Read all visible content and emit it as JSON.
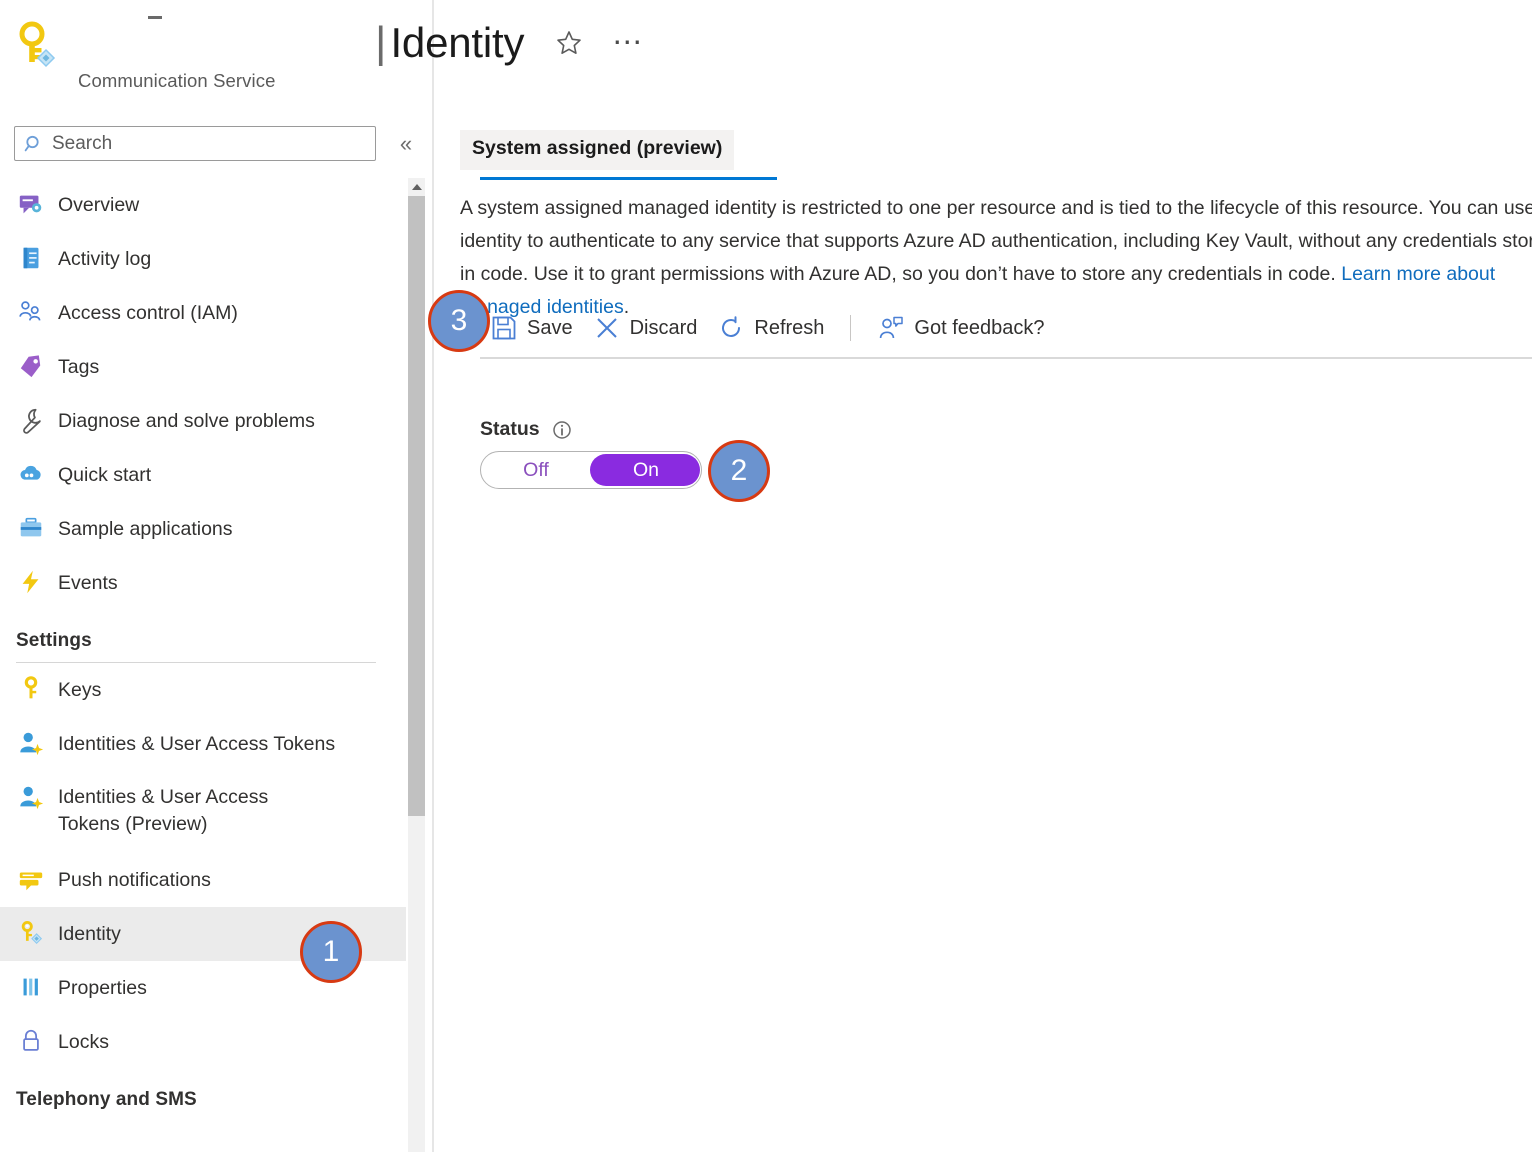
{
  "resource": {
    "type_label": "Communication Service",
    "icon": "key-diamond-icon"
  },
  "search": {
    "placeholder": "Search",
    "value": "",
    "icon": "search-icon"
  },
  "collapse": {
    "glyph": "«",
    "name": "collapse-panel-chevron-icon"
  },
  "blade": {
    "separator": "|",
    "title": "Identity",
    "favorite_icon": "star-icon",
    "more_icon": "ellipsis-icon"
  },
  "sidebar": {
    "items": [
      {
        "label": "Overview",
        "icon": "overview-icon",
        "selected": false
      },
      {
        "label": "Activity log",
        "icon": "activity-log-icon",
        "selected": false
      },
      {
        "label": "Access control (IAM)",
        "icon": "access-control-icon",
        "selected": false
      },
      {
        "label": "Tags",
        "icon": "tag-icon",
        "selected": false
      },
      {
        "label": "Diagnose and solve problems",
        "icon": "wrench-icon",
        "selected": false
      },
      {
        "label": "Quick start",
        "icon": "cloud-icon",
        "selected": false
      },
      {
        "label": "Sample applications",
        "icon": "briefcase-icon",
        "selected": false
      },
      {
        "label": "Events",
        "icon": "lightning-icon",
        "selected": false
      }
    ],
    "groups": [
      {
        "title": "Settings",
        "items": [
          {
            "label": "Keys",
            "icon": "key-icon",
            "selected": false
          },
          {
            "label": "Identities & User Access Tokens",
            "icon": "user-add-icon",
            "selected": false
          },
          {
            "label": "Identities & User Access Tokens (Preview)",
            "icon": "user-add-icon",
            "selected": false,
            "tall": true
          },
          {
            "label": "Push notifications",
            "icon": "push-notification-icon",
            "selected": false
          },
          {
            "label": "Identity",
            "icon": "key-diamond-icon",
            "selected": true
          },
          {
            "label": "Properties",
            "icon": "properties-icon",
            "selected": false
          },
          {
            "label": "Locks",
            "icon": "lock-icon",
            "selected": false
          }
        ]
      },
      {
        "title": "Telephony and SMS",
        "items": []
      }
    ]
  },
  "main": {
    "tabs": [
      {
        "label": "System assigned (preview)",
        "active": true
      }
    ],
    "description": {
      "text_before_link": "A system assigned managed identity is restricted to one per resource and is tied to the lifecycle of this resource. You can use the identity to authenticate to any service that supports Azure AD authentication, including Key Vault, without any credentials stored in code. Use it to grant permissions with Azure AD, so you don’t have to store any credentials in code. ",
      "link_text": "Learn more about Managed identities",
      "text_after_link": "."
    },
    "toolbar": {
      "save_label": "Save",
      "save_icon": "save-disk-icon",
      "discard_label": "Discard",
      "discard_icon": "close-x-icon",
      "refresh_label": "Refresh",
      "refresh_icon": "refresh-circle-icon",
      "feedback_label": "Got feedback?",
      "feedback_icon": "feedback-person-icon"
    },
    "status": {
      "label": "Status",
      "info_icon": "info-icon",
      "options": [
        "Off",
        "On"
      ],
      "value": "On"
    }
  },
  "annotations": [
    {
      "number": "1",
      "target": "sidebar-item-identity"
    },
    {
      "number": "2",
      "target": "status-toggle"
    },
    {
      "number": "3",
      "target": "toolbar"
    }
  ],
  "colors": {
    "accent": "#0078d4",
    "toggle_on": "#8a2be0",
    "link": "#0f6cbd",
    "badge_fill": "#6b93cf",
    "badge_border": "#d73a13"
  }
}
